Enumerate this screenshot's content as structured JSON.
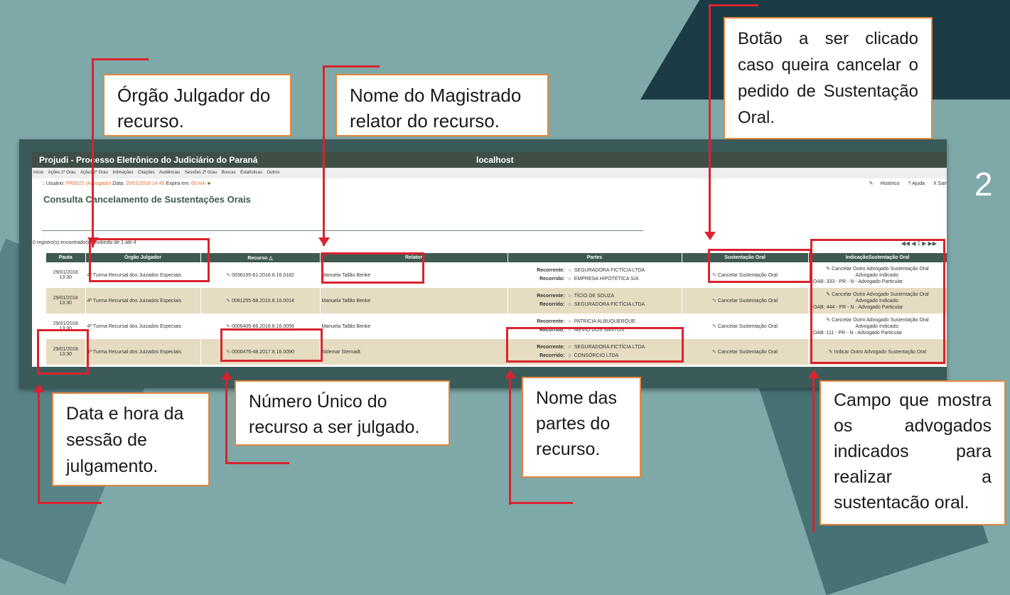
{
  "slide": {
    "number": "2"
  },
  "app": {
    "title": "Projudi - Processo Eletrônico do Judiciário do Paraná",
    "host": "localhost",
    "menu": [
      "Início",
      "Ações 1º Grau",
      "Ações 2º Grau",
      "Intimações",
      "Citações",
      "Audiências",
      "Sessões 2º Grau",
      "Buscas",
      "Estatísticas",
      "Outros"
    ],
    "user_label": ":: Usuário:",
    "user_value": "PR0022 (Advogado)",
    "date_label": "Data:",
    "date_value": "25/01/2018 14:45",
    "expires_label": "Expira em:",
    "expires_value": "60 min",
    "links": {
      "historico": "Histórico",
      "ajuda": "? Ajuda",
      "sair": "X Sair"
    },
    "page_title": "Consulta Cancelamento de Sustentações Orais",
    "records_info": "0 registro(s) encontrado(s), exibindo de 1 até 4",
    "pager": "◀◀ ◀ 1 ▶ ▶▶",
    "columns": [
      "Pauta",
      "Órgão Julgador",
      "Recurso",
      "Relator",
      "Partes",
      "Sustentação Oral",
      "IndicaçãoSustentação Oral"
    ],
    "rows": [
      {
        "date": "29/01/2018",
        "time": "13:30",
        "orgao": "4ª Turma Recursal dos Juizados Especiais",
        "recurso": "0036155-61.2016.8.16.0182",
        "relator": "Manuela Tallão Benke",
        "recorrente": "SEGURADORA FICTÍCIA LTDA",
        "recorrido": "EMPRESA HIPOTÉTICA S/A",
        "sustentacao": "Cancelar Sustentação Oral",
        "indic_action": "Cancelar Outro Advogado Sustentação Oral",
        "indic_label": "Advogado Indicado:",
        "indic_oab": "OAB: 333 - PR - N - Advogado Particular"
      },
      {
        "date": "29/01/2018",
        "time": "13:30",
        "orgao": "4ª Turma Recursal dos Juizados Especiais",
        "recurso": "0081255-58.2016.8.16.0014",
        "relator": "Manuela Tallão Benke",
        "recorrente": "TÍCIO DE SOUZA",
        "recorrido": "SEGURADORA FICTÍCIA LTDA",
        "sustentacao": "Cancelar Sustentação Oral",
        "indic_action": "Cancelar Outro Advogado Sustentação Oral",
        "indic_label": "Advogado Indicado:",
        "indic_oab": "OAB: 444 - PR - N - Advogado Particular"
      },
      {
        "date": "29/01/2018",
        "time": "13:30",
        "orgao": "4ª Turma Recursal dos Juizados Especiais",
        "recurso": "0005405-66.2016.8.16.0056",
        "relator": "Manuela Tallão Benke",
        "recorrente": "PATRICIA ALBUQUERQUE",
        "recorrido": "MÉVIO DOS SANTOS",
        "sustentacao": "Cancelar Sustentação Oral",
        "indic_action": "Cancelar Outro Advogado Sustentação Oral",
        "indic_label": "Advogado Indicado:",
        "indic_oab": "OAB: 111 - PR - N - Advogado Particular"
      },
      {
        "date": "29/01/2018",
        "time": "13:30",
        "orgao": "4ª Turma Recursal dos Juizados Especiais",
        "recurso": "0000476-48.2017.8.16.0090",
        "relator": "Aldemar Sternadt",
        "recorrente": "SEGURADORA FICTÍCIA LTDA",
        "recorrido": "CONSÓRCIO LTDA",
        "sustentacao": "Cancelar Sustentação Oral",
        "indic_action": "Indicar Outro Advogado Sustentação Oral",
        "indic_label": "",
        "indic_oab": ""
      }
    ],
    "role_recorrente": "Recorrente:",
    "role_recorrido": "Recorrido:"
  },
  "callouts": {
    "orgao": "Órgão Julgador do recurso.",
    "relator": "Nome do Magistrado relator do recurso.",
    "botao": "Botão a ser clicado caso queira cancelar o pedido de Sustentação Oral.",
    "data": "Data e hora da sessão de julgamento.",
    "numero": "Número Único do recurso a ser julgado.",
    "partes": "Nome das partes do recurso.",
    "campo": "Campo que mostra os advogados indicados para realizar a sustentacão oral."
  },
  "colors": {
    "accent_red": "#d9232e",
    "callout_border": "#e2873a",
    "header_green": "#3f5a50",
    "row_alt": "#e6dcc1"
  }
}
